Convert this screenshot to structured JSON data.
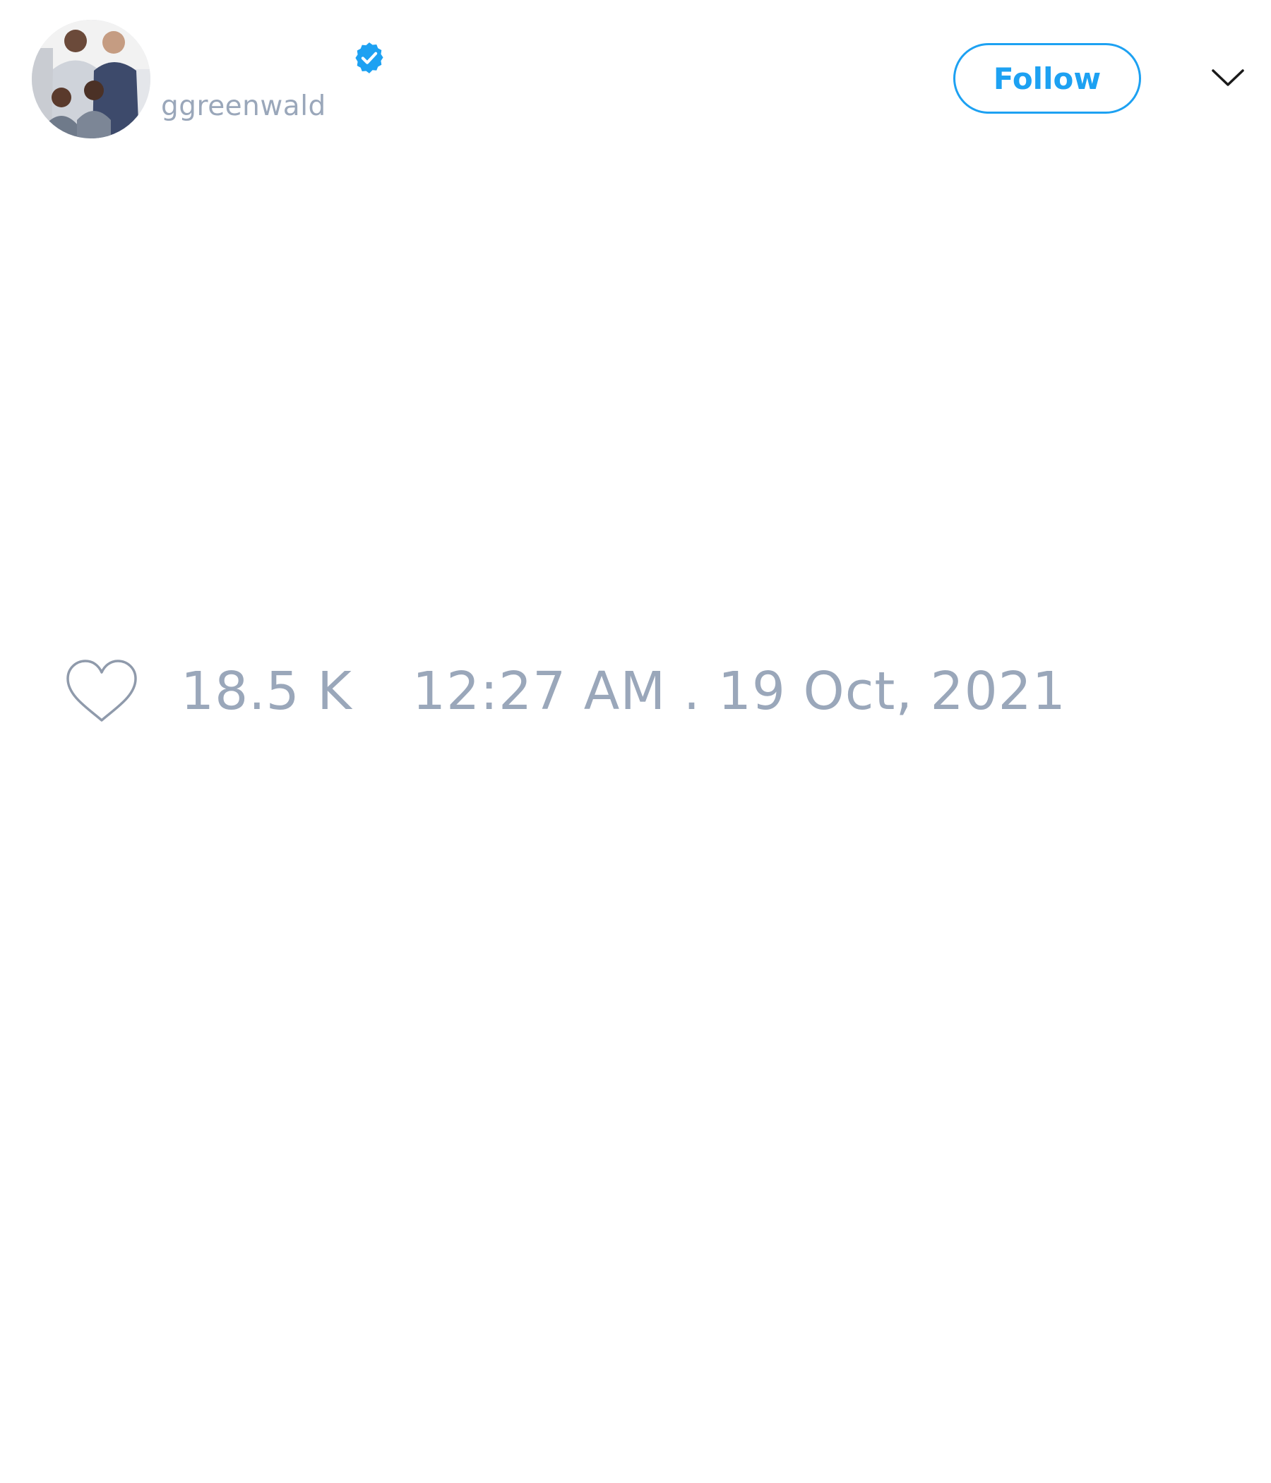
{
  "profile": {
    "handle": "ggreenwald",
    "verified": true,
    "avatar": "profile-photo"
  },
  "actions": {
    "follow_label": "Follow",
    "more_icon": "chevron-down-icon"
  },
  "stats": {
    "like_icon": "heart-icon",
    "likes": "18.5 K",
    "timestamp": "12:27 AM . 19 Oct, 2021"
  },
  "colors": {
    "accent": "#1da1f2",
    "muted_text": "#9aa7ba",
    "icon_stroke": "#8f9aab"
  }
}
